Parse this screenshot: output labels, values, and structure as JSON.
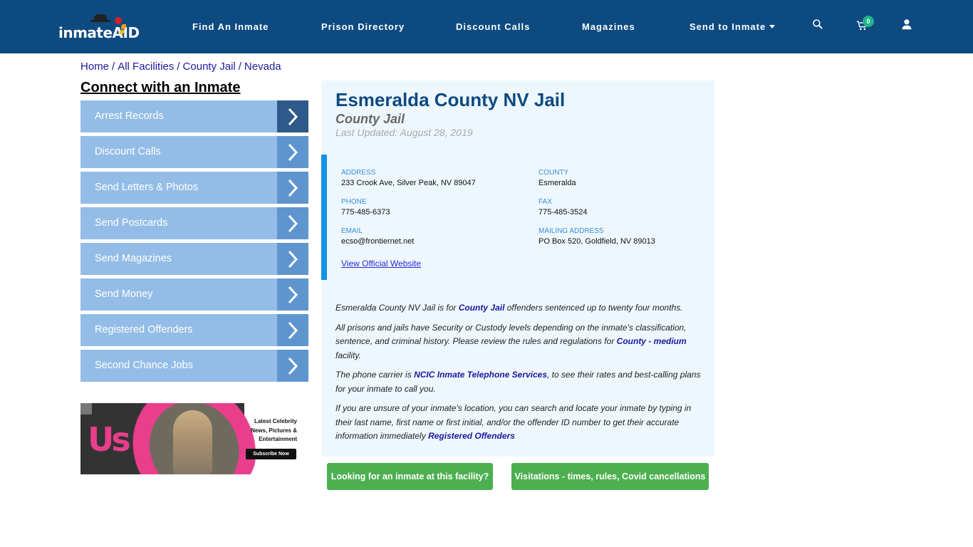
{
  "header": {
    "logo": "inmateAID",
    "nav": [
      {
        "label": "Find An Inmate"
      },
      {
        "label": "Prison Directory"
      },
      {
        "label": "Discount Calls"
      },
      {
        "label": "Magazines"
      },
      {
        "label": "Send to Inmate",
        "has_dropdown": true
      }
    ],
    "icons": [
      "search-icon",
      "cart-icon",
      "user-icon"
    ],
    "cart_count": "0",
    "colors": {
      "nav_bg": "#0d4a80",
      "badge": "#20b28c"
    }
  },
  "breadcrumb": [
    {
      "label": "Home"
    },
    {
      "label": "All Facilities"
    },
    {
      "label": "County Jail"
    },
    {
      "label": "Nevada"
    }
  ],
  "breadcrumb_separator": "/",
  "sidebar": {
    "title": "Connect with an Inmate",
    "items": [
      {
        "label": "Arrest Records"
      },
      {
        "label": "Discount Calls"
      },
      {
        "label": "Send Letters & Photos"
      },
      {
        "label": "Send Postcards"
      },
      {
        "label": "Send Magazines"
      },
      {
        "label": "Send Money"
      },
      {
        "label": "Registered Offenders"
      },
      {
        "label": "Second Chance Jobs"
      }
    ],
    "ad": {
      "brand": "Us",
      "copy": "Latest Celebrity News, Pictures & Entertainment",
      "cta": "Subscribe Now"
    }
  },
  "facility": {
    "name": "Esmeralda County NV Jail",
    "type": "County Jail",
    "last_updated": "Last Updated: August 28, 2019",
    "fields": {
      "address": {
        "label": "ADDRESS",
        "value": "233 Crook Ave, Silver Peak, NV 89047"
      },
      "county": {
        "label": "COUNTY",
        "value": "Esmeralda"
      },
      "phone": {
        "label": "PHONE",
        "value": "775-485-6373"
      },
      "fax": {
        "label": "FAX",
        "value": "775-485-3524"
      },
      "email": {
        "label": "EMAIL",
        "value": "ecso@frontiernet.net"
      },
      "mailing": {
        "label": "MAILING ADDRESS",
        "value": "PO Box 520, Goldfield, NV 89013"
      }
    },
    "website_link": "View Official Website",
    "description": {
      "p1_a": "Esmeralda County NV Jail is for ",
      "p1_link": "County Jail",
      "p1_b": " offenders sentenced up to twenty four months.",
      "p2_a": "All prisons and jails have Security or Custody levels depending on the inmate's classification, sentence, and criminal history. Please review the rules and regulations for ",
      "p2_link": "County - medium",
      "p2_b": " facility.",
      "p3_a": "The phone carrier is ",
      "p3_link": "NCIC Inmate Telephone Services",
      "p3_b": ", to see their rates and best-calling plans for your inmate to call you.",
      "p4_a": "If you are unsure of your inmate's location, you can search and locate your inmate by typing in their last name, first name or first initial, and/or the offender ID number to get their accurate information immediately ",
      "p4_link": "Registered Offenders"
    }
  },
  "actions": {
    "find_inmate": "Looking for an inmate at this facility?",
    "visitations": "Visitations - times, rules, Covid cancellations"
  }
}
